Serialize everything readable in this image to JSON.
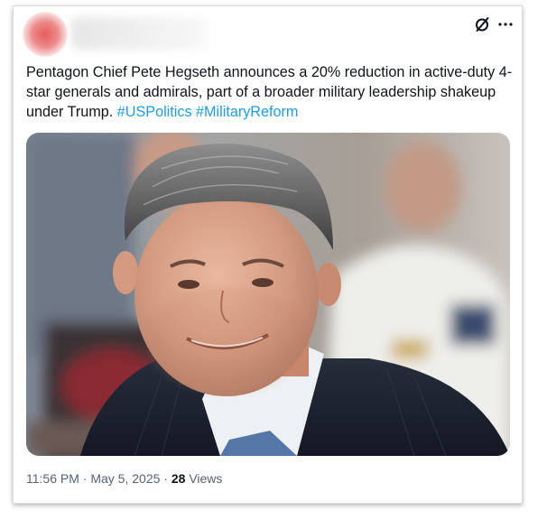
{
  "post": {
    "text_main": "Pentagon Chief Pete Hegseth announces a 20% reduction in active-duty 4-star generals and admirals, part of a broader military leadership shakeup under Trump.",
    "hashtags": [
      "#USPolitics",
      "#MilitaryReform"
    ],
    "time": "11:56 PM",
    "separator": "·",
    "date": "May 5, 2025",
    "views_count": "28",
    "views_label": "Views"
  },
  "icons": {
    "grok": "grok-icon",
    "more": "more-icon"
  },
  "colors": {
    "link": "#1d9bf0",
    "text": "#0f1419",
    "muted": "#536471",
    "avatar_accent": "#e85c5c"
  }
}
